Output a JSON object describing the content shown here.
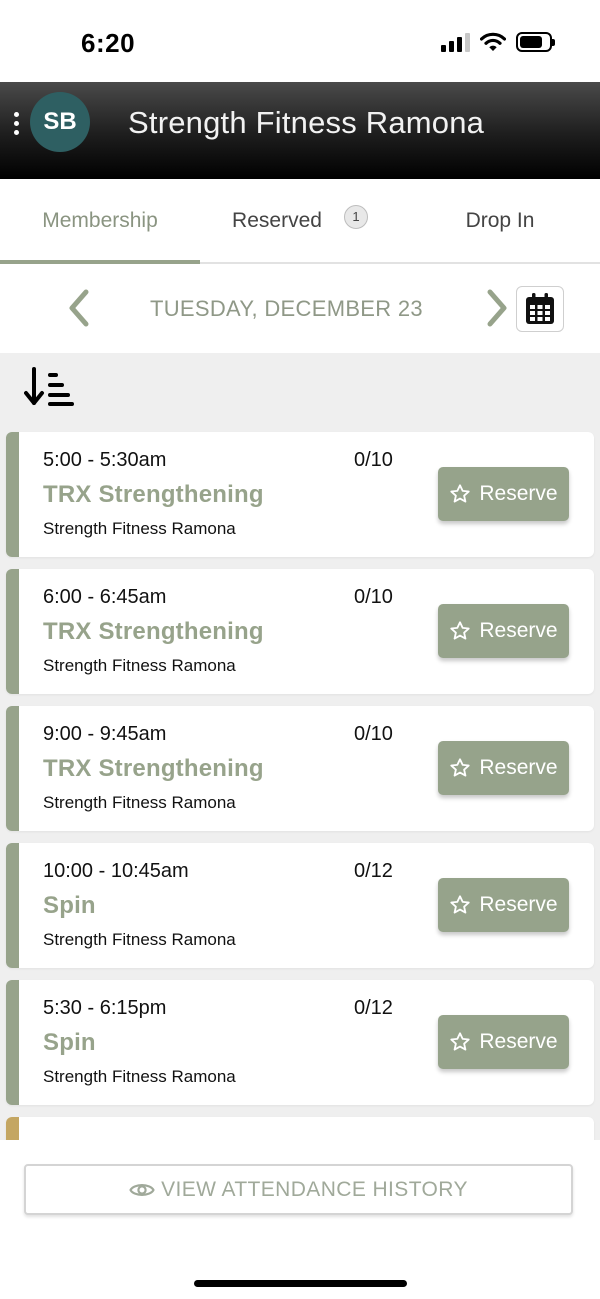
{
  "status_bar": {
    "time": "6:20"
  },
  "header": {
    "avatar_initials": "SB",
    "title": "Strength Fitness Ramona"
  },
  "tabs": [
    {
      "label": "Membership",
      "active": true
    },
    {
      "label": "Reserved",
      "badge": "1",
      "active": false
    },
    {
      "label": "Drop In",
      "active": false
    }
  ],
  "date_nav": {
    "date": "TUESDAY, DECEMBER 23"
  },
  "classes": [
    {
      "time": "5:00 - 5:30am",
      "capacity": "0/10",
      "name": "TRX Strengthening",
      "location": "Strength Fitness Ramona",
      "action": "Reserve"
    },
    {
      "time": "6:00 - 6:45am",
      "capacity": "0/10",
      "name": "TRX Strengthening",
      "location": "Strength Fitness Ramona",
      "action": "Reserve"
    },
    {
      "time": "9:00 - 9:45am",
      "capacity": "0/10",
      "name": "TRX Strengthening",
      "location": "Strength Fitness Ramona",
      "action": "Reserve"
    },
    {
      "time": "10:00 - 10:45am",
      "capacity": "0/12",
      "name": "Spin",
      "location": "Strength Fitness Ramona",
      "action": "Reserve"
    },
    {
      "time": "5:30 - 6:15pm",
      "capacity": "0/12",
      "name": "Spin",
      "location": "Strength Fitness Ramona",
      "action": "Reserve"
    }
  ],
  "footer": {
    "history_label": "VIEW ATTENDANCE HISTORY"
  },
  "colors": {
    "accent": "#97a38b",
    "header_dark": "#1d1d1d",
    "avatar": "#2e5f62",
    "partial_card_bar": "#c4a662"
  }
}
